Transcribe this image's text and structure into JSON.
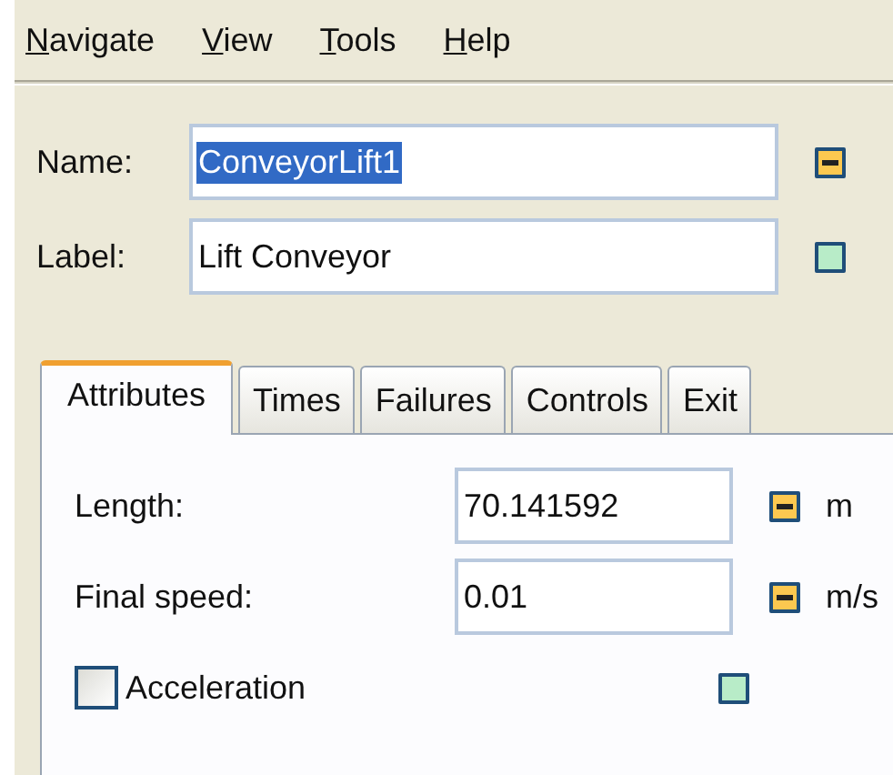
{
  "menu": [
    {
      "key": "N",
      "rest": "avigate"
    },
    {
      "key": "V",
      "rest": "iew"
    },
    {
      "key": "T",
      "rest": "ools"
    },
    {
      "key": "H",
      "rest": "elp"
    }
  ],
  "header_fields": [
    {
      "label": "Name:",
      "value": "ConveyorLift1",
      "value_selected": true,
      "marker": {
        "kind": "minus"
      }
    },
    {
      "label": "Label:",
      "value": "Lift Conveyor",
      "value_selected": false,
      "marker": {
        "kind": "plain"
      }
    }
  ],
  "tabs": [
    {
      "label": "Attributes",
      "selected": true
    },
    {
      "label": "Times",
      "selected": false
    },
    {
      "label": "Failures",
      "selected": false
    },
    {
      "label": "Controls",
      "selected": false
    },
    {
      "label": "Exit",
      "selected": false
    }
  ],
  "attributes": [
    {
      "kind": "field",
      "label": "Length:",
      "value": "70.141592",
      "marker": {
        "kind": "minus"
      },
      "unit": "m"
    },
    {
      "kind": "field",
      "label": "Final speed:",
      "value": "0.01",
      "marker": {
        "kind": "minus"
      },
      "unit": "m/s"
    },
    {
      "kind": "checkbox",
      "label": "Acceleration",
      "checked": false,
      "marker": {
        "kind": "plain"
      }
    }
  ]
}
